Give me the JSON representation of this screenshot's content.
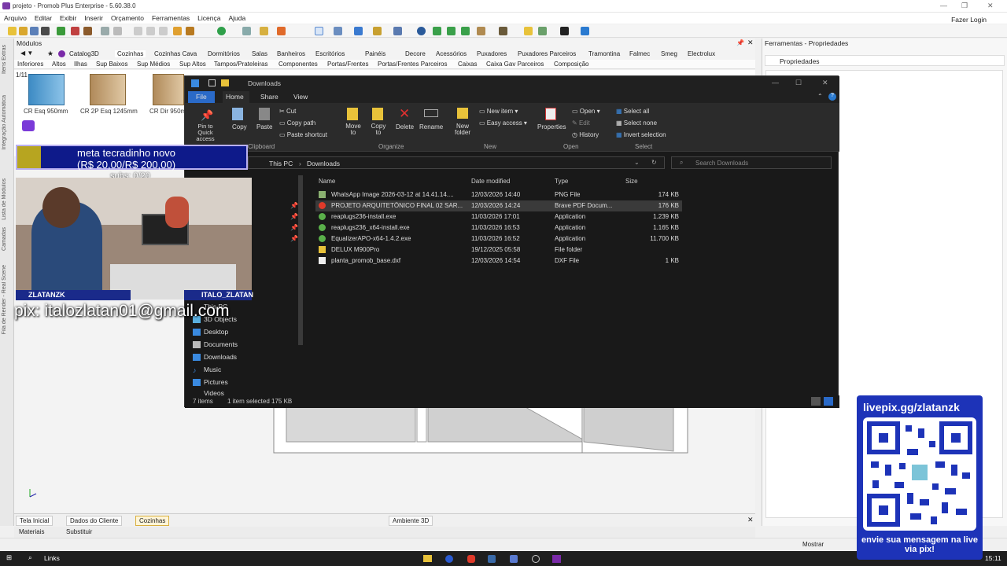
{
  "app": {
    "title": "projeto - Promob Plus Enterprise - 5.60.38.0",
    "login": "Fazer Login"
  },
  "menu": [
    "Arquivo",
    "Editar",
    "Exibir",
    "Inserir",
    "Orçamento",
    "Ferramentas",
    "Licença",
    "Ajuda"
  ],
  "modules": {
    "header": "Módulos",
    "page": "1/11",
    "catalog": "Catalog3D",
    "tabs": [
      "Cozinhas",
      "Cozinhas Cava",
      "Dormitórios",
      "Salas",
      "Banheiros",
      "Escritórios",
      "Painéis",
      "Decore",
      "Acessórios",
      "Puxadores",
      "Puxadores Parceiros",
      "Tramontina",
      "Falmec",
      "Smeg",
      "Electrolux"
    ],
    "subtabs": [
      "Inferiores",
      "Altos",
      "Ilhas",
      "Sup Baixos",
      "Sup Médios",
      "Sup Altos",
      "Tampos/Prateleiras",
      "Componentes",
      "Portas/Frentes",
      "Portas/Frentes Parceiros",
      "Caixas",
      "Caixa Gav Parceiros",
      "Composição"
    ],
    "items": [
      "CR Esq 950mm",
      "CR 2P Esq 1245mm",
      "CR Dir 950m"
    ]
  },
  "left_strip": [
    "Itens Extras",
    "Integração Automática",
    "Lista de Módulos",
    "Camadas",
    "Fila de Render - Real Scene"
  ],
  "bottom_tabs": [
    "Tela Inicial",
    "Dados do Cliente",
    "Cozinhas"
  ],
  "scene_tab": "Ambiente 3D",
  "bottom2": [
    "Materiais",
    "Substituir"
  ],
  "right_panel": {
    "header": "Ferramentas - Propriedades",
    "properties": "Propriedades"
  },
  "status": {
    "mostrar": "Mostrar",
    "clock": "15:11"
  },
  "taskbar": {
    "links": "Links"
  },
  "explorer": {
    "title": "Downloads",
    "tabs": [
      "File",
      "Home",
      "Share",
      "View"
    ],
    "ribbon": {
      "pin": "Pin to Quick access",
      "copy": "Copy",
      "paste": "Paste",
      "cut": "Cut",
      "copy_path": "Copy path",
      "paste_shortcut": "Paste shortcut",
      "clipboard": "Clipboard",
      "move_to": "Move to",
      "copy_to": "Copy to",
      "delete": "Delete",
      "rename": "Rename",
      "organize": "Organize",
      "new_folder": "New folder",
      "new_item": "New item",
      "easy_access": "Easy access",
      "new": "New",
      "properties": "Properties",
      "open_btn": "Open",
      "edit": "Edit",
      "history": "History",
      "open": "Open",
      "select_all": "Select all",
      "select_none": "Select none",
      "invert_selection": "Invert selection",
      "select": "Select"
    },
    "address": [
      "This PC",
      "Downloads"
    ],
    "search_placeholder": "Search Downloads",
    "columns": [
      "Name",
      "Date modified",
      "Type",
      "Size"
    ],
    "files": [
      {
        "name": "WhatsApp Image 2026-03-12 at 14.41.14....",
        "date": "12/03/2026 14:40",
        "type": "PNG File",
        "size": "174 KB",
        "icon": "image-icon"
      },
      {
        "name": "PROJETO ARQUITETÔNICO FINAL 02 SAR...",
        "date": "12/03/2026 14:24",
        "type": "Brave PDF Docum...",
        "size": "176 KB",
        "icon": "pdf-icon"
      },
      {
        "name": "reaplugs236-install.exe",
        "date": "11/03/2026 17:01",
        "type": "Application",
        "size": "1.239 KB",
        "icon": "installer-icon"
      },
      {
        "name": "reaplugs236_x64-install.exe",
        "date": "11/03/2026 16:53",
        "type": "Application",
        "size": "1.165 KB",
        "icon": "installer-icon"
      },
      {
        "name": "EqualizerAPO-x64-1.4.2.exe",
        "date": "11/03/2026 16:52",
        "type": "Application",
        "size": "11.700 KB",
        "icon": "installer-icon"
      },
      {
        "name": "DELUX M900Pro",
        "date": "19/12/2025 05:58",
        "type": "File folder",
        "size": "",
        "icon": "folder-icon"
      },
      {
        "name": "planta_promob_base.dxf",
        "date": "12/03/2026 14:54",
        "type": "DXF File",
        "size": "1 KB",
        "icon": "file-icon"
      }
    ],
    "nav": [
      "This PC",
      "3D Objects",
      "Desktop",
      "Documents",
      "Downloads",
      "Music",
      "Pictures",
      "Videos"
    ],
    "status": {
      "items": "7 items",
      "selected": "1 item selected  175 KB"
    }
  },
  "stream": {
    "goal_title": "meta tecradinho novo",
    "goal_amount": "(R$ 20,00/R$ 200,00)",
    "subs": "subs: 0/20",
    "name_left": "ZLATANZK",
    "name_right": "ITALO_ZLATAN",
    "pix": "pix: italozlatan01@gmail.com",
    "qr_url": "livepix.gg/zlatanzk",
    "qr_msg": "envie sua mensagem na live via pix!"
  }
}
